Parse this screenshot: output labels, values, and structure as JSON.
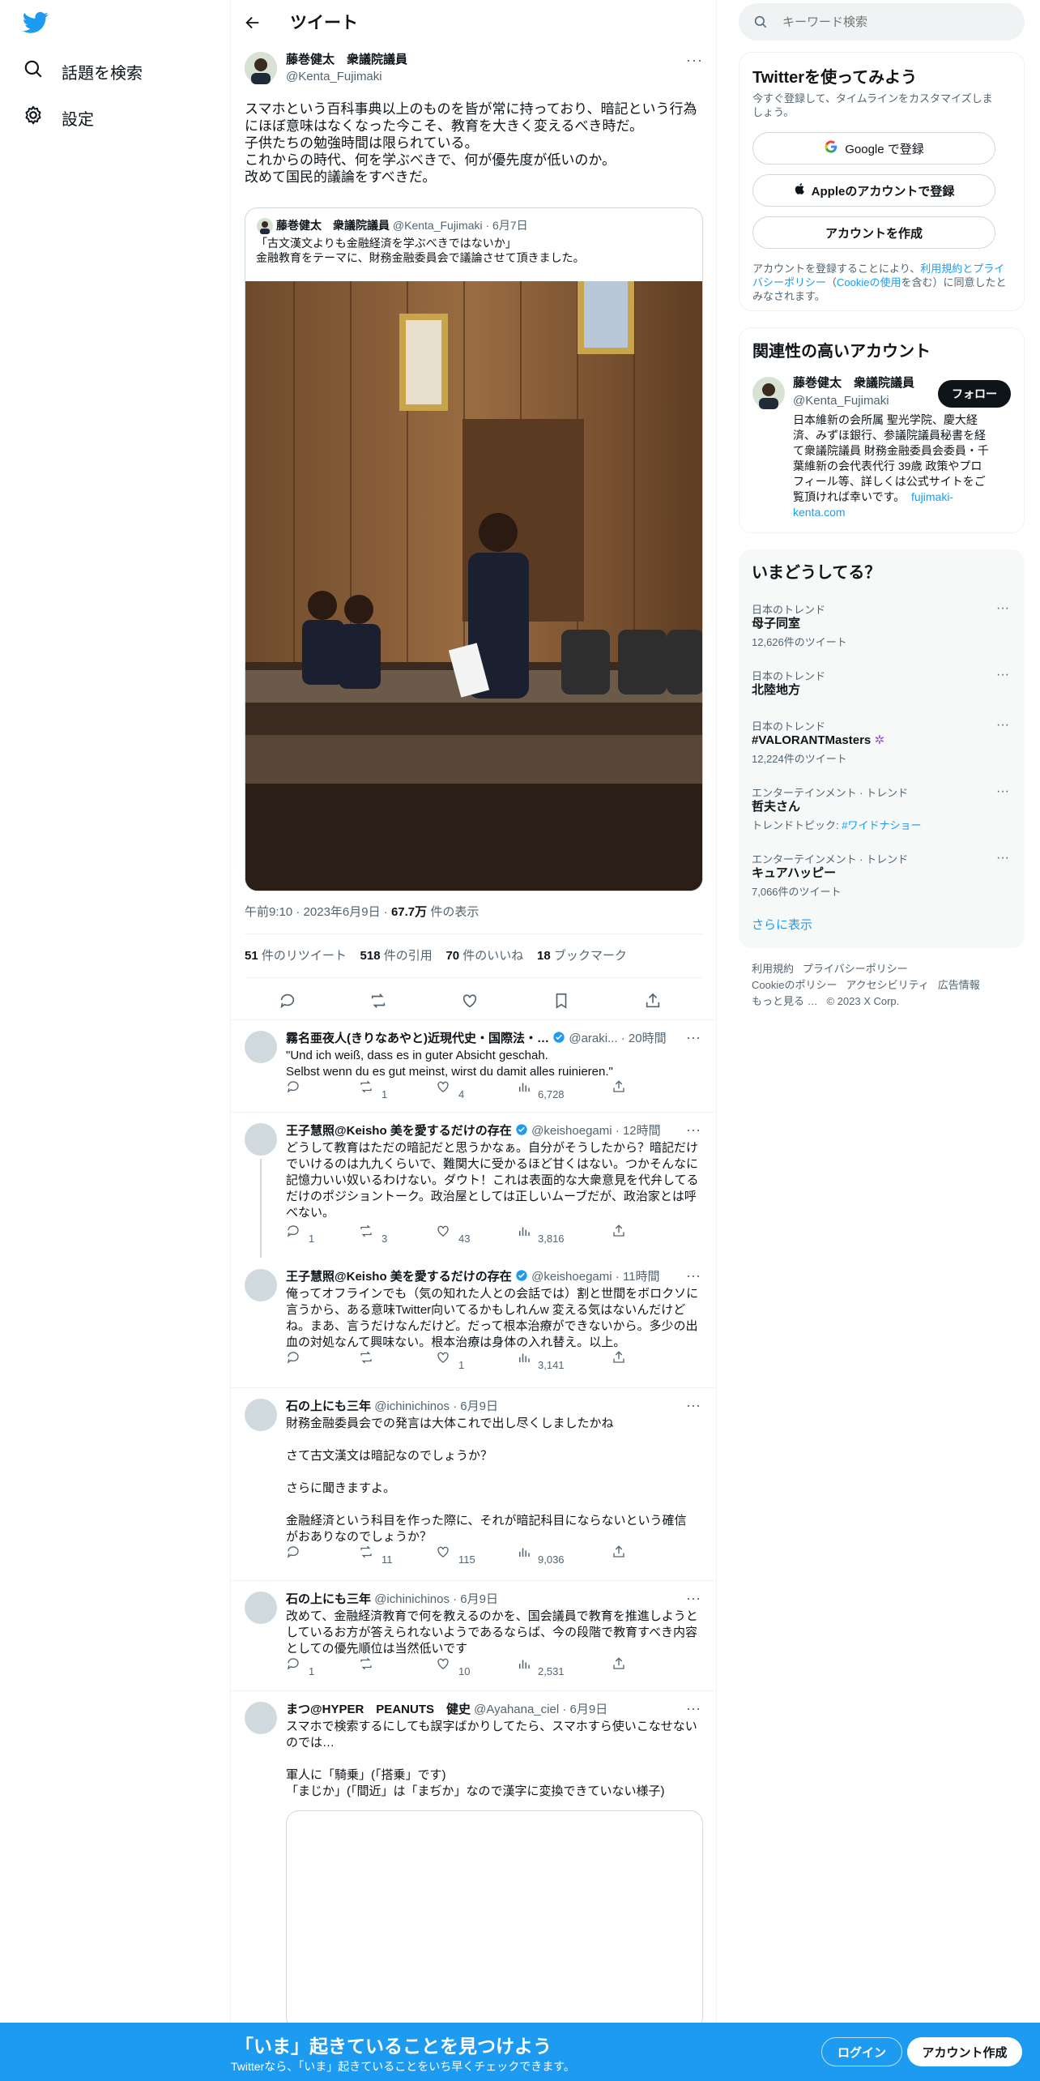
{
  "nav": {
    "explore": "話題を検索",
    "settings": "設定"
  },
  "header": {
    "title": "ツイート"
  },
  "tweet": {
    "author_name": "藤巻健太　衆議院議員",
    "author_handle": "@Kenta_Fujimaki",
    "lines": [
      "スマホという百科事典以上のものを皆が常に持っており、暗記という行為",
      "にほぼ意味はなくなった今こそ、教育を大きく変えるべき時だ。",
      "子供たちの勉強時間は限られている。",
      "これからの時代、何を学ぶべきで、何が優先度が低いのか。",
      "改めて国民的議論をすべきだ。"
    ],
    "quote": {
      "author_name": "藤巻健太　衆議院議員",
      "author_handle": "@Kenta_Fujimaki",
      "date": "· 6月7日",
      "line1": "「古文漢文よりも金融経済を学ぶべきではないか」",
      "line2": "金融教育をテーマに、財務金融委員会で議論させて頂きました。"
    },
    "time": "午前9:10",
    "date": "2023年6月9日",
    "views": "67.7万",
    "views_label": "件の表示",
    "stats": {
      "retweets": "51",
      "retweets_label": "件のリツイート",
      "quotes": "518",
      "quotes_label": "件の引用",
      "likes": "70",
      "likes_label": "件のいいね",
      "bookmarks": "18",
      "bookmarks_label": "ブックマーク"
    }
  },
  "replies": [
    {
      "name": "霧名亜夜人(きりなあやと)近現代史・国際法・…",
      "handle": "@araki...",
      "time": "· 20時間",
      "lines": [
        "\"Und ich weiß, dass es in guter Absicht geschah.",
        "Selbst wenn du es gut meinst, wirst du damit alles ruinieren.\""
      ],
      "replies": "",
      "retweets": "1",
      "likes": "4",
      "views": "6,728"
    },
    {
      "name": "王子慧照@Keisho 美を愛するだけの存在",
      "handle": "@keishoegami",
      "time": "· 12時間",
      "lines": [
        "どうして教育はただの暗記だと思うかなぁ。自分がそうしたから？暗記だけ",
        "でいけるのは九九くらいで、難関大に受かるほど甘くはない。つかそんなに",
        "記憶力いい奴いるわけない。ダウト！これは表面的な大衆意見を代弁してる",
        "だけのポジショントーク。政治屋としては正しいムーブだが、政治家とは呼",
        "べない。"
      ],
      "replies": "1",
      "retweets": "3",
      "likes": "43",
      "views": "3,816"
    },
    {
      "name": "王子慧照@Keisho 美を愛するだけの存在",
      "handle": "@keishoegami",
      "time": "· 11時間",
      "lines": [
        "俺ってオフラインでも（気の知れた人との会話では）割と世間をボロクソに",
        "言うから、ある意味Twitter向いてるかもしれんw 変える気はないんだけど",
        "ね。まあ、言うだけなんだけど。だって根本治療ができないから。多少の出",
        "血の対処なんて興味ない。根本治療は身体の入れ替え。以上。"
      ],
      "replies": "",
      "retweets": "",
      "likes": "1",
      "views": "3,141"
    },
    {
      "name": "石の上にも三年",
      "handle": "@ichinichinos",
      "time": "· 6月9日",
      "lines": [
        "財務金融委員会での発言は大体これで出し尽くしましたかね",
        "",
        "さて古文漢文は暗記なのでしょうか？",
        "",
        "さらに聞きますよ。",
        "",
        "金融経済という科目を作った際に、それが暗記科目にならないという確信",
        "がおありなのでしょうか？"
      ],
      "replies": "",
      "retweets": "11",
      "likes": "115",
      "views": "9,036"
    },
    {
      "name": "石の上にも三年",
      "handle": "@ichinichinos",
      "time": "· 6月9日",
      "lines": [
        "改めて、金融経済教育で何を教えるのかを、国会議員で教育を推進しようと",
        "しているお方が答えられないようであるならば、今の段階で教育すべき内容",
        "としての優先順位は当然低いです"
      ],
      "replies": "1",
      "retweets": "",
      "likes": "10",
      "views": "2,531"
    },
    {
      "name": "まつ@HYPER　PEANUTS　健史",
      "handle": "@Ayahana_ciel",
      "time": "· 6月9日",
      "lines": [
        "スマホで検索するにしても誤字ばかりしてたら、スマホすら使いこなせない",
        "のでは…",
        "",
        "軍人に「騎乗」(「搭乗」です)",
        "「まじか」(「間近」は「まぢか」なので漢字に変換できていない様子)"
      ],
      "replies": "",
      "retweets": "",
      "likes": "",
      "views": ""
    }
  ],
  "right": {
    "search_placeholder": "キーワード検索",
    "signup": {
      "title": "Twitterを使ってみよう",
      "subtitle_1": "今すぐ登録して、タイムラインをカスタマイズしま",
      "subtitle_2": "しょう。",
      "google": "Google で登録",
      "apple": "Appleのアカウントで登録",
      "create": "アカウントを作成",
      "terms_1a": "アカウントを登録することにより、",
      "terms_1b": "利用規約",
      "terms_1c": "とプライ",
      "terms_2a": "バシーポリシー",
      "terms_2b": "（",
      "terms_2c": "Cookieの使用",
      "terms_2d": "を含む）に同意したと",
      "terms_3": "みなされます。"
    },
    "related": {
      "title": "関連性の高いアカウント",
      "name": "藤巻健太　衆議院議員",
      "handle": "@Kenta_Fujimaki",
      "follow": "フォロー",
      "bio": [
        "日本維新の会所属 聖光学院、慶大経",
        "済、みずほ銀行、参議院議員秘書を経",
        "て衆議院議員 財務金融委員会委員・千",
        "葉維新の会代表代行 39歳 政策やプロ",
        "フィール等、詳しくは公式サイトをご",
        "覧頂ければ幸いです。"
      ],
      "link1": "fujimaki-",
      "link2": "kenta.com"
    },
    "trends": {
      "title": "いまどうしてる？",
      "items": [
        {
          "context": "日本のトレンド",
          "name": "母子同室",
          "meta": "12,626件のツイート"
        },
        {
          "context": "日本のトレンド",
          "name": "北陸地方",
          "meta": ""
        },
        {
          "context": "日本のトレンド",
          "name": "#VALORANTMasters",
          "meta": "12,224件のツイート"
        },
        {
          "context": "エンターテインメント · トレンド",
          "name": "哲夫さん",
          "meta": "トレンドトピック: ",
          "meta_link": "#ワイドナショー"
        },
        {
          "context": "エンターテインメント · トレンド",
          "name": "キュアハッピー",
          "meta": "7,066件のツイート"
        }
      ],
      "show_more": "さらに表示"
    },
    "footer": {
      "terms": "利用規約",
      "privacy": "プライバシーポリシー",
      "cookie": "Cookieのポリシー",
      "accessibility": "アクセシビリティ",
      "ads": "広告情報",
      "more": "もっと見る …",
      "copyright": "© 2023 X Corp."
    }
  },
  "bottom": {
    "headline": "「いま」起きていることを見つけよう",
    "sub": "Twitterなら、「いま」起きていることをいち早くチェックできます。",
    "login": "ログイン",
    "signup": "アカウント作成"
  },
  "colors": {
    "accent": "#1d9bf0",
    "text": "#0f1419",
    "muted": "#536471"
  }
}
